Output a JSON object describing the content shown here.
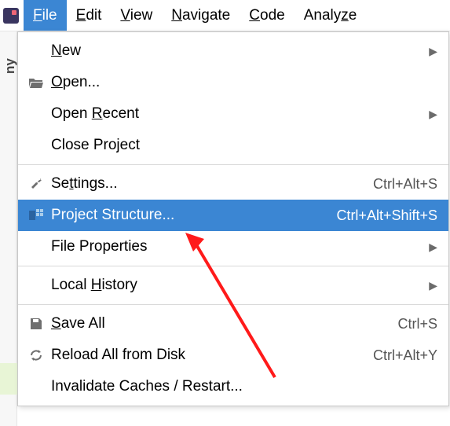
{
  "menubar": {
    "items": [
      {
        "label": "File",
        "mn": "F",
        "rest": "ile"
      },
      {
        "label": "Edit",
        "mn": "E",
        "rest": "dit"
      },
      {
        "label": "View",
        "mn": "V",
        "rest": "iew"
      },
      {
        "label": "Navigate",
        "mn": "N",
        "rest": "avigate"
      },
      {
        "label": "Code",
        "mn": "C",
        "rest": "ode"
      },
      {
        "label": "Analyze",
        "mn": "",
        "rest": "Analy",
        "mn2": "z",
        "rest2": "e"
      }
    ]
  },
  "sidebar": {
    "project_fragment": "ny"
  },
  "menu": {
    "new": "ew",
    "new_mn": "N",
    "open": "pen...",
    "open_mn": "O",
    "openrecent_pre": "Open ",
    "openrecent_mn": "R",
    "openrecent_post": "ecent",
    "close": "Close Project",
    "settings_pre": "Se",
    "settings_mn": "t",
    "settings_post": "tings...",
    "settings_shortcut": "Ctrl+Alt+S",
    "projstruct": "Project Structure...",
    "projstruct_shortcut": "Ctrl+Alt+Shift+S",
    "fileprops": "File Properties",
    "localhist_pre": "Local ",
    "localhist_mn": "H",
    "localhist_post": "istory",
    "saveall_mn": "S",
    "saveall_rest": "ave All",
    "saveall_shortcut": "Ctrl+S",
    "reload": "Reload All from Disk",
    "reload_shortcut": "Ctrl+Alt+Y",
    "invalidate": "Invalidate Caches / Restart..."
  }
}
